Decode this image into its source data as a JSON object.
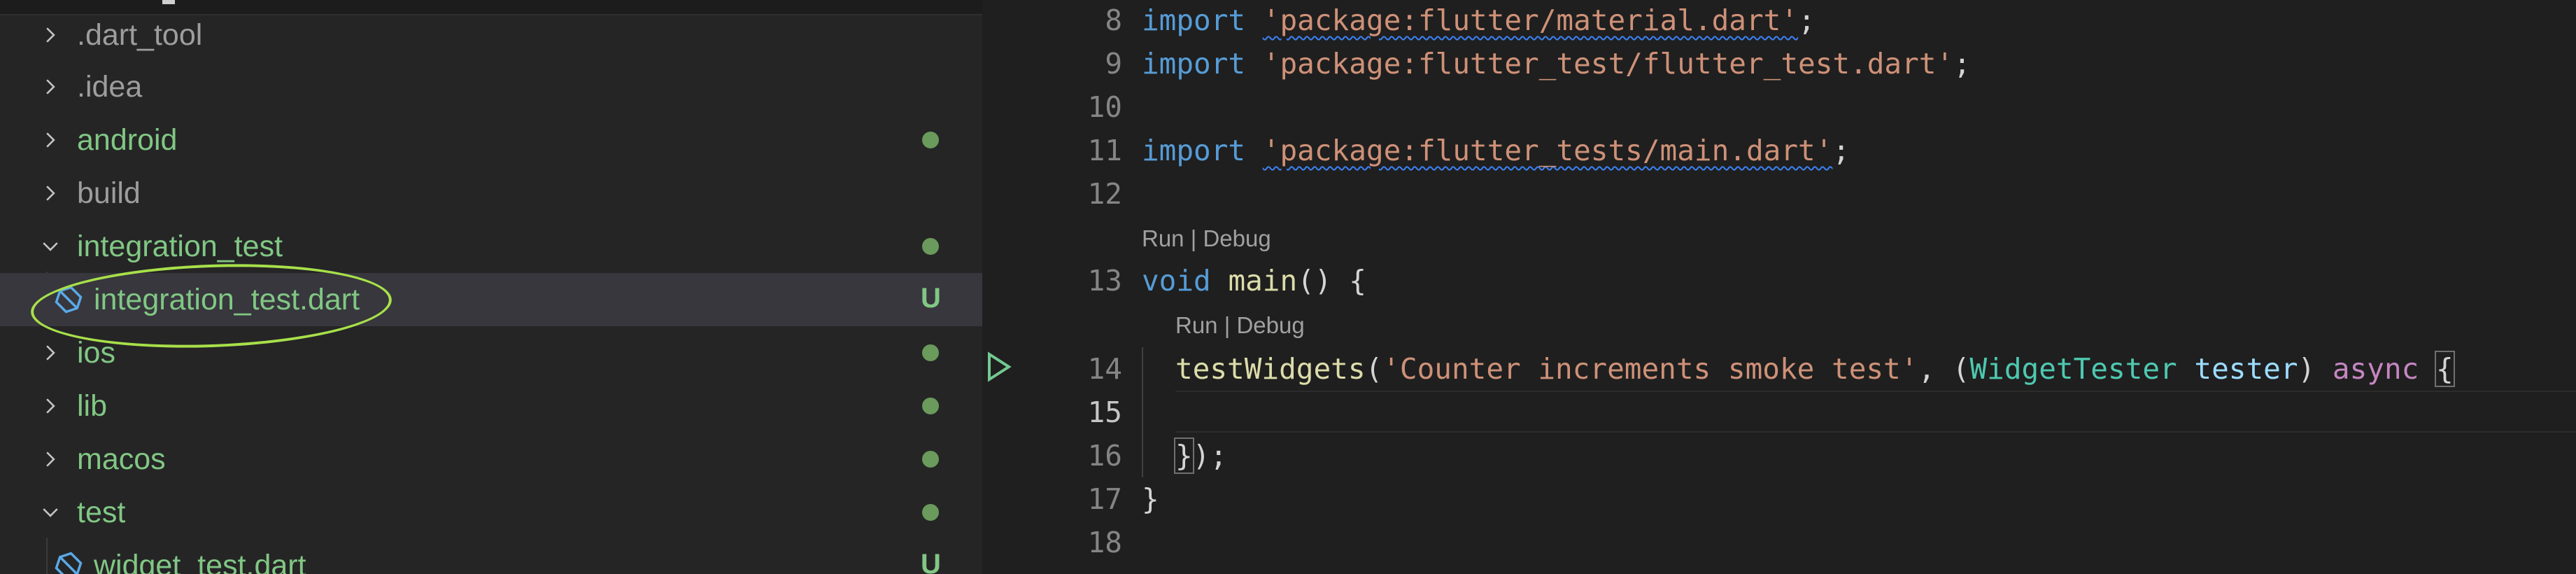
{
  "explorer": {
    "items": [
      {
        "label": ".dart_tool",
        "expanded": false,
        "color": "grey",
        "status": ""
      },
      {
        "label": ".idea",
        "expanded": false,
        "color": "grey",
        "status": ""
      },
      {
        "label": "android",
        "expanded": false,
        "color": "green",
        "status": "dot"
      },
      {
        "label": "build",
        "expanded": false,
        "color": "grey",
        "status": ""
      },
      {
        "label": "integration_test",
        "expanded": true,
        "color": "green",
        "status": "dot"
      },
      {
        "label": "integration_test.dart",
        "file": true,
        "color": "green",
        "status": "U",
        "selected": true
      },
      {
        "label": "ios",
        "expanded": false,
        "color": "green",
        "status": "dot"
      },
      {
        "label": "lib",
        "expanded": false,
        "color": "green",
        "status": "dot"
      },
      {
        "label": "macos",
        "expanded": false,
        "color": "green",
        "status": "dot"
      },
      {
        "label": "test",
        "expanded": true,
        "color": "green",
        "status": "dot"
      },
      {
        "label": "widget_test.dart",
        "file": true,
        "color": "green",
        "status": "U"
      }
    ]
  },
  "editor": {
    "line_numbers": [
      "8",
      "9",
      "10",
      "11",
      "12",
      "13",
      "14",
      "15",
      "16",
      "17",
      "18"
    ],
    "codelens_main": "Run | Debug",
    "codelens_test": "Run | Debug",
    "tokens": {
      "import": "import",
      "void": "void",
      "main": "main",
      "testWidgets": "testWidgets",
      "async": "async",
      "WidgetTester": "WidgetTester",
      "tester": "tester",
      "str_material": "'package:flutter/material.dart'",
      "str_flutter_test": "'package:flutter_test/flutter_test.dart'",
      "str_main": "'package:flutter_tests/main.dart'",
      "str_desc": "'Counter increments smoke test'"
    }
  },
  "colors": {
    "keyword": "#569cd6",
    "control": "#c586c0",
    "string": "#ce9178",
    "function": "#dcdcaa",
    "type": "#4ec9b0",
    "variable": "#9cdcfe",
    "git_added": "#81c784",
    "annotation_circle": "#a8e04a"
  }
}
